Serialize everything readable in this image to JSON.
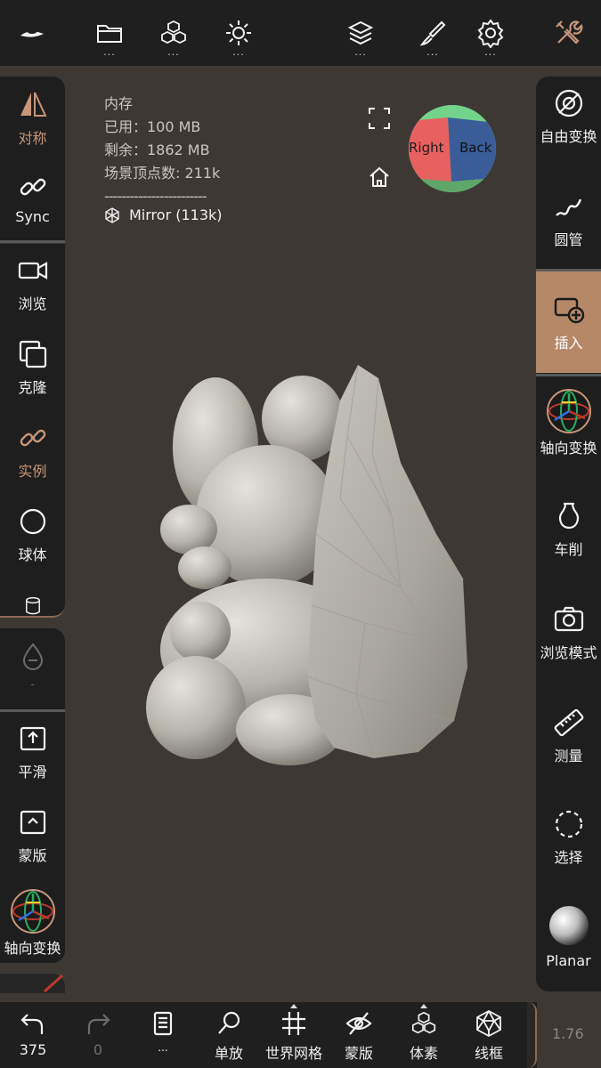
{
  "topbar": {
    "buttons": [
      {
        "icon": "logo-icon"
      },
      {
        "icon": "folder-icon",
        "more": "..."
      },
      {
        "icon": "cubes-icon",
        "more": "..."
      },
      {
        "icon": "sun-icon",
        "more": "..."
      },
      {
        "icon": "layers-icon",
        "more": "..."
      },
      {
        "icon": "brush-icon",
        "more": "..."
      },
      {
        "icon": "gear-icon",
        "more": "..."
      },
      {
        "icon": "tools-icon"
      }
    ]
  },
  "left_tools": {
    "symmetry": "对称",
    "sync": "Sync",
    "view": "浏览",
    "clone": "克隆",
    "instance": "实例",
    "sphere": "球体",
    "dim_label": "-",
    "smooth": "平滑",
    "mask": "蒙版",
    "gizmo": "轴向变换"
  },
  "right_tools": {
    "free_transform": "自由变换",
    "tube": "圆管",
    "insert": "插入",
    "gizmo": "轴向变换",
    "lathe": "车削",
    "view_mode": "浏览模式",
    "measure": "测量",
    "select": "选择",
    "planar": "Planar"
  },
  "info": {
    "memory": "内存",
    "used": "已用：100 MB",
    "free": "剩余：1862 MB",
    "vertices": "场景顶点数: 211k",
    "divider": "------------------------",
    "mirror": "Mirror (113k)"
  },
  "viewcube": {
    "right": "Right",
    "back": "Back"
  },
  "bottombar": {
    "undo_count": "375",
    "redo_count": "0",
    "scene_more": "...",
    "single": "单放",
    "world_grid": "世界网格",
    "mask": "蒙版",
    "voxel": "体素",
    "wireframe": "线框"
  },
  "zoom": "1.76",
  "colors": {
    "accent": "#c8967a",
    "insert_active": "#b58868",
    "background": "#3e3835",
    "panel": "#1e1e1e"
  }
}
